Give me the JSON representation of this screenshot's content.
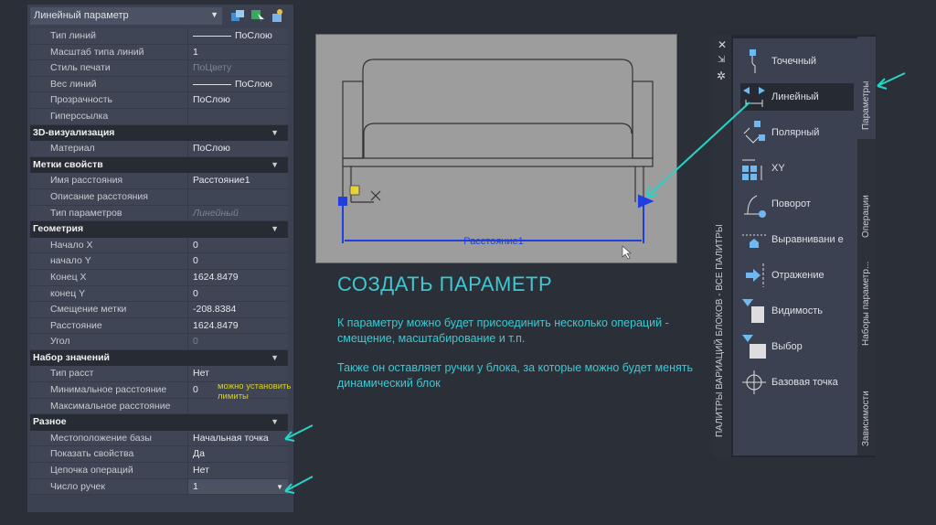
{
  "properties": {
    "selector": "Линейный параметр",
    "general": [
      {
        "label": "Тип линий",
        "value": "ПоСлою",
        "line": true
      },
      {
        "label": "Масштаб типа линий",
        "value": "1"
      },
      {
        "label": "Стиль печати",
        "value": "ПоЦвету",
        "dim": true
      },
      {
        "label": "Вес линий",
        "value": "ПоСлою",
        "line": true
      },
      {
        "label": "Прозрачность",
        "value": "ПоСлою"
      },
      {
        "label": "Гиперссылка",
        "value": ""
      }
    ],
    "sections": [
      {
        "title": "3D-визуализация",
        "rows": [
          {
            "label": "Материал",
            "value": "ПоСлою"
          }
        ]
      },
      {
        "title": "Метки свойств",
        "rows": [
          {
            "label": "Имя расстояния",
            "value": "Расстояние1"
          },
          {
            "label": "Описание расстояния",
            "value": ""
          },
          {
            "label": "Тип параметров",
            "value": "Линейный",
            "italic": true
          }
        ]
      },
      {
        "title": "Геометрия",
        "rows": [
          {
            "label": "Начало X",
            "value": "0"
          },
          {
            "label": "начало Y",
            "value": "0"
          },
          {
            "label": "Конец X",
            "value": "1624.8479"
          },
          {
            "label": " конец Y",
            "value": "0"
          },
          {
            "label": "Смещение метки",
            "value": "-208.8384"
          },
          {
            "label": "Расстояние",
            "value": "1624.8479"
          },
          {
            "label": "Угол",
            "value": "0",
            "dim": true
          }
        ]
      },
      {
        "title": "Набор значений",
        "rows": [
          {
            "label": "Тип расст",
            "value": "Нет"
          },
          {
            "label": "Минимальное расстояние",
            "value": "0",
            "note": "можно установить лимиты"
          },
          {
            "label": "Максимальное расстояние",
            "value": ""
          }
        ]
      },
      {
        "title": "Разное",
        "rows": [
          {
            "label": "Местоположение базы",
            "value": "Начальная точка"
          },
          {
            "label": "Показать свойства",
            "value": "Да"
          },
          {
            "label": "Цепочка операций",
            "value": "Нет"
          },
          {
            "label": "Число ручек",
            "value": "1",
            "select": true
          }
        ]
      }
    ]
  },
  "drawing": {
    "dimension_label": "Расстояние1"
  },
  "slide": {
    "title": "СОЗДАТЬ ПАРАМЕТР",
    "p1": "К параметру можно будет присоединить несколько операций - смещение, масштабирование и т.п.",
    "p2": "Также он оставляет ручки у блока, за которые можно будет менять динамический блок"
  },
  "palette": {
    "title": "ПАЛИТРЫ ВАРИАЦИЙ БЛОКОВ - ВСЕ ПАЛИТРЫ",
    "items": [
      "Точечный",
      "Линейный",
      "Полярный",
      "XY",
      "Поворот",
      "Выравнивани е",
      "Отражение",
      "Видимость",
      "Выбор",
      "Базовая точка"
    ],
    "tabs": [
      "Параметры",
      "Операции",
      "Наборы параметр...",
      "Зависимости"
    ]
  },
  "colors": {
    "accent": "#3fc8d2",
    "dimension": "#1f3fe0",
    "canvas": "#9d9d9d"
  }
}
